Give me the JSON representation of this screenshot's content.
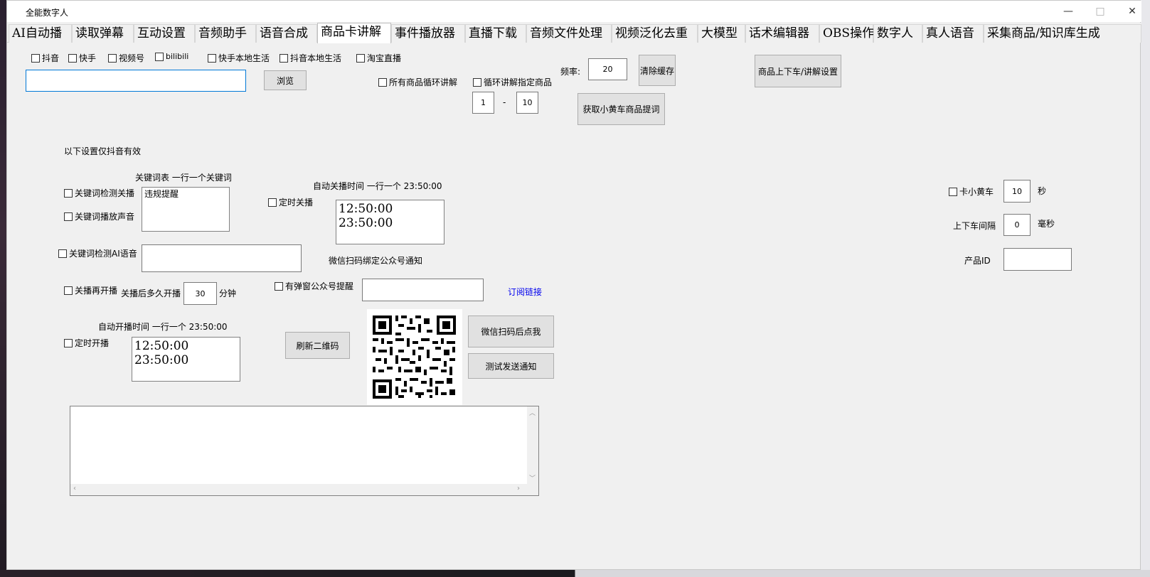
{
  "window": {
    "title": "全能数字人",
    "minimize": "—",
    "maximize": "□",
    "close": "✕"
  },
  "tabs": [
    "AI自动播",
    "读取弹幕",
    "互动设置",
    "音频助手",
    "语音合成",
    "商品卡讲解",
    "事件播放器",
    "直播下载",
    "音频文件处理",
    "视频泛化去重",
    "大模型",
    "话术编辑器",
    "OBS操作",
    "数字人",
    "真人语音",
    "采集商品/知识库生成"
  ],
  "active_tab_index": 5,
  "platforms": [
    "抖音",
    "快手",
    "视频号",
    "bilibili",
    "快手本地生活",
    "抖音本地生活",
    "淘宝直播"
  ],
  "path_input": "",
  "browse_button": "浏览",
  "loop_all": "所有商品循环讲解",
  "loop_specific": "循环讲解指定商品",
  "range_from": "1",
  "range_sep": "-",
  "range_to": "10",
  "freq_label": "频率:",
  "freq_value": "20",
  "clear_cache_button": "清除缓存",
  "get_cart_button": "获取小黄车商品提词",
  "product_settings_button": "商品上下车/讲解设置",
  "douyin_only_note": "以下设置仅抖音有效",
  "keyword_table_label": "关键词表  一行一个关键词",
  "keyword_close_cb": "关键词检测关播",
  "keyword_sound_cb": "关键词播放声音",
  "keyword_list": "违规提醒",
  "auto_close_label": "自动关播时间  一行一个  23:50:00",
  "timed_close_cb": "定时关播",
  "close_times": "12:50:00\n23:50:00",
  "keyword_ai_cb": "关键词检测AI语音",
  "keyword_ai_input": "",
  "wechat_bind_label": "微信扫码绑定公众号通知",
  "reopen_cb": "关播再开播",
  "reopen_after_label": "关播后多久开播",
  "reopen_minutes": "30",
  "minutes_unit": "分钟",
  "popup_notify_cb": "有弹窗公众号提醒",
  "popup_input": "",
  "subscribe_link": "订阅链接",
  "auto_open_label": "自动开播时间  一行一个  23:50:00",
  "timed_open_cb": "定时开播",
  "open_times": "12:50:00\n23:50:00",
  "refresh_qr_button": "刷新二维码",
  "wechat_scan_button": "微信扫码后点我",
  "test_notify_button": "测试发送通知",
  "log_text": "",
  "cart_cb": "卡小黄车",
  "cart_value": "10",
  "cart_unit": "秒",
  "interval_label": "上下车间隔",
  "interval_value": "0",
  "interval_unit": "毫秒",
  "product_id_label": "产品ID",
  "product_id_value": ""
}
